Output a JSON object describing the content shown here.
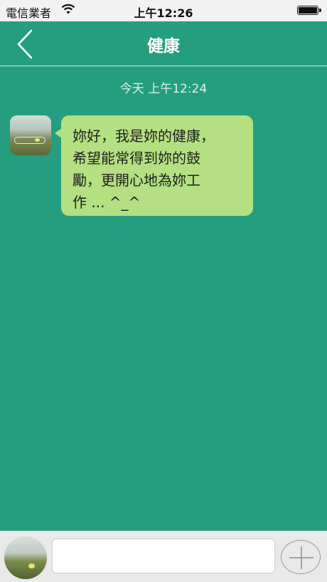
{
  "status_bar": {
    "carrier": "電信業者",
    "time": "上午12:26",
    "battery_level": 1.0
  },
  "nav": {
    "title": "健康",
    "back_icon": "chevron-left-icon"
  },
  "chat": {
    "timestamp": "今天 上午12:24",
    "messages": [
      {
        "sender_avatar": "avatar",
        "text": "妳好，我是妳的健康，\n希望能常得到妳的鼓\n勵，更開心地為妳工\n作 ... ^_^"
      }
    ]
  },
  "composer": {
    "input_value": "",
    "input_placeholder": "",
    "add_icon": "plus-icon"
  },
  "colors": {
    "background": "#259e7f",
    "bubble": "#b4e081",
    "input_bar": "#e9e9e9"
  }
}
